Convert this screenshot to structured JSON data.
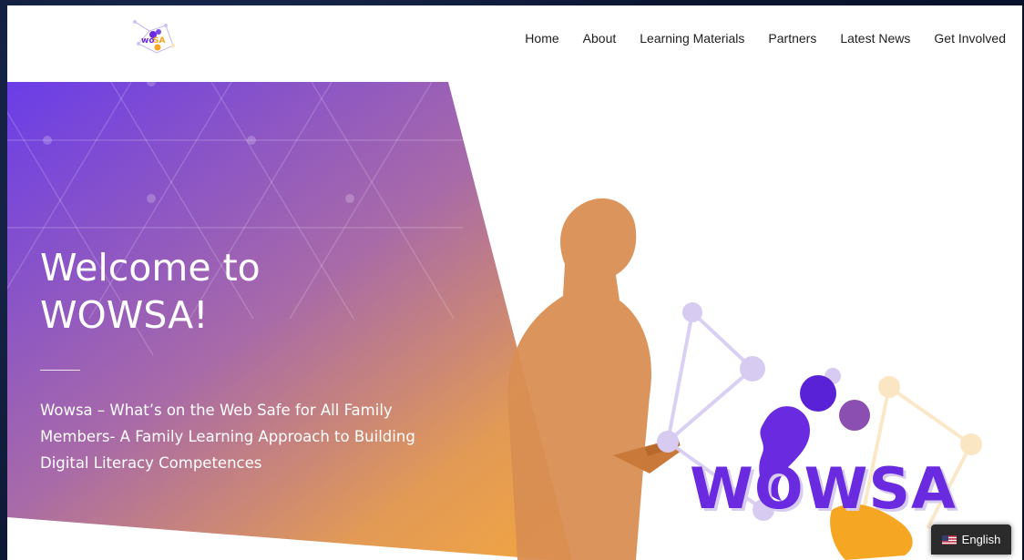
{
  "header": {
    "logo_alt": "WOWSA",
    "nav": [
      "Home",
      "About",
      "Learning Materials",
      "Partners",
      "Latest News",
      "Get Involved"
    ]
  },
  "hero": {
    "title_line1": "Welcome to",
    "title_line2": "WOWSA!",
    "subtitle": "Wowsa – What’s on the Web Safe for All Family Members- A Family Learning Approach to Building Digital Literacy Competences",
    "brand_word": "WOWSA"
  },
  "language": {
    "label": "English",
    "flag_icon": "us-flag-icon"
  },
  "colors": {
    "gradient_start": "#6a3de8",
    "gradient_end": "#f7a93b",
    "brand_purple": "#6a2be0",
    "brand_orange": "#f5a623"
  }
}
